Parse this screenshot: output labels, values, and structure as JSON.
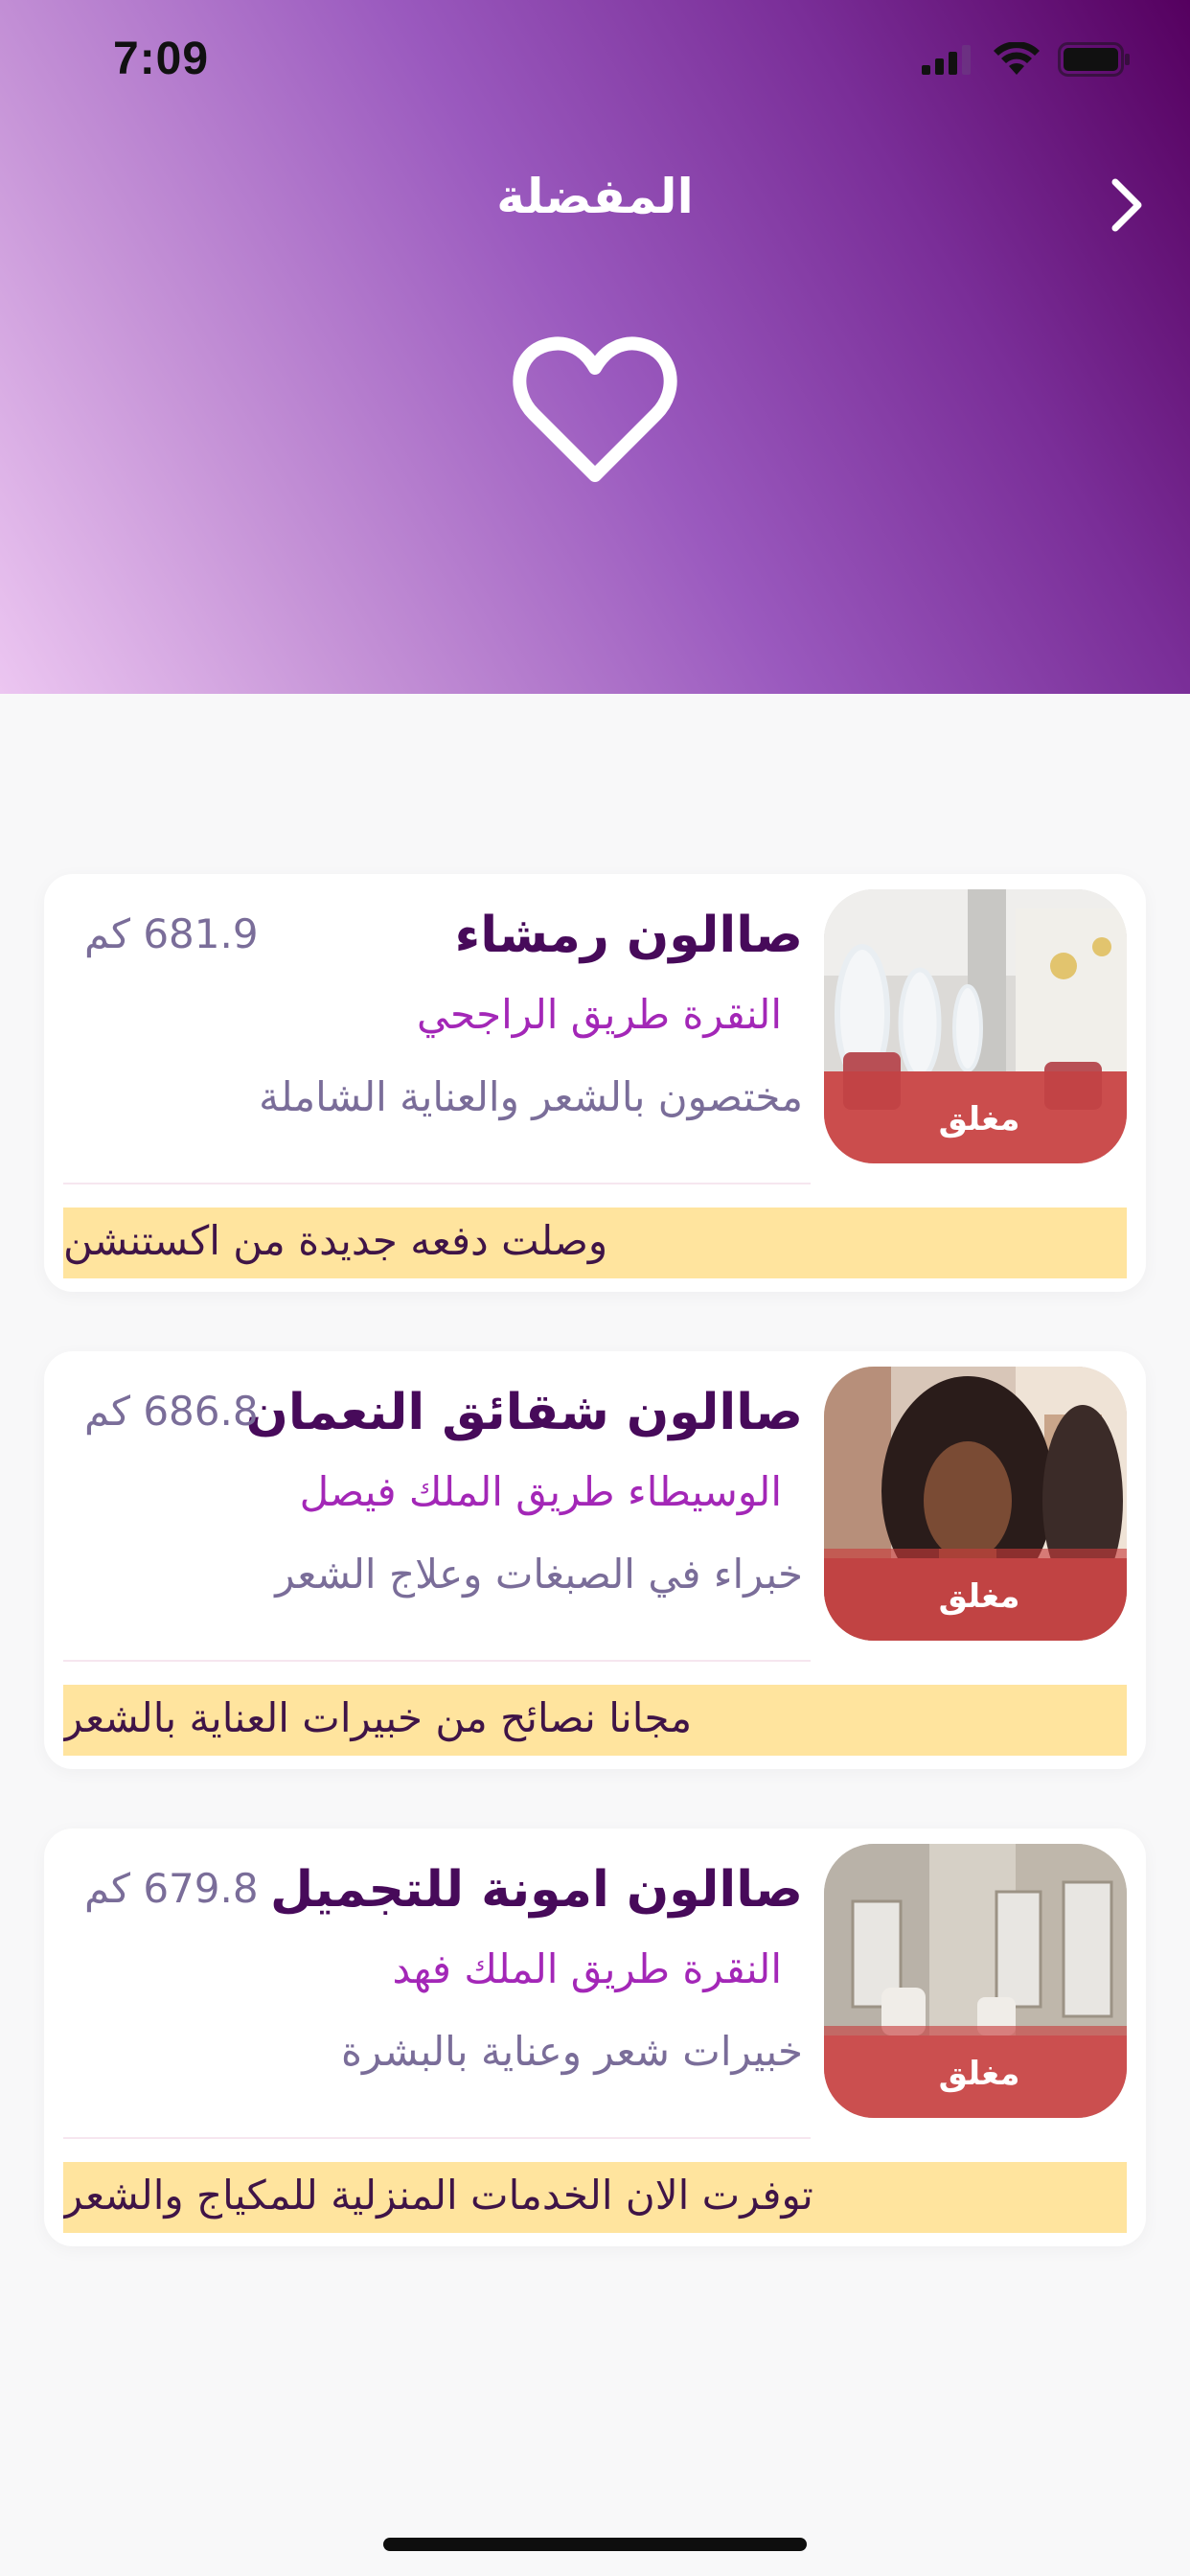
{
  "status_bar": {
    "time": "7:09"
  },
  "header": {
    "title": "المفضلة"
  },
  "salons": [
    {
      "name": "صاالون رمشاء",
      "distance": "681.9 كم",
      "address": "النقرة طريق الراجحي",
      "description": "مختصون بالشعر والعناية الشاملة",
      "status": "مغلق",
      "announcement": "وصلت دفعه جديدة من اكستنشن"
    },
    {
      "name": "صاالون شقائق النعمان",
      "distance": "686.8 كم",
      "address": "الوسيطاء طريق الملك فيصل",
      "description": "خبراء في الصبغات وعلاج الشعر",
      "status": "مغلق",
      "announcement": "مجانا نصائح من خبيرات العناية بالشعر"
    },
    {
      "name": "صاالون امونة للتجميل",
      "distance": "679.8 كم",
      "address": "النقرة  طريق الملك فهد",
      "description": "خبيرات شعر وعناية بالبشرة",
      "status": "مغلق",
      "announcement": "توفرت الان الخدمات المنزلية للمكياج والشعر"
    }
  ]
}
